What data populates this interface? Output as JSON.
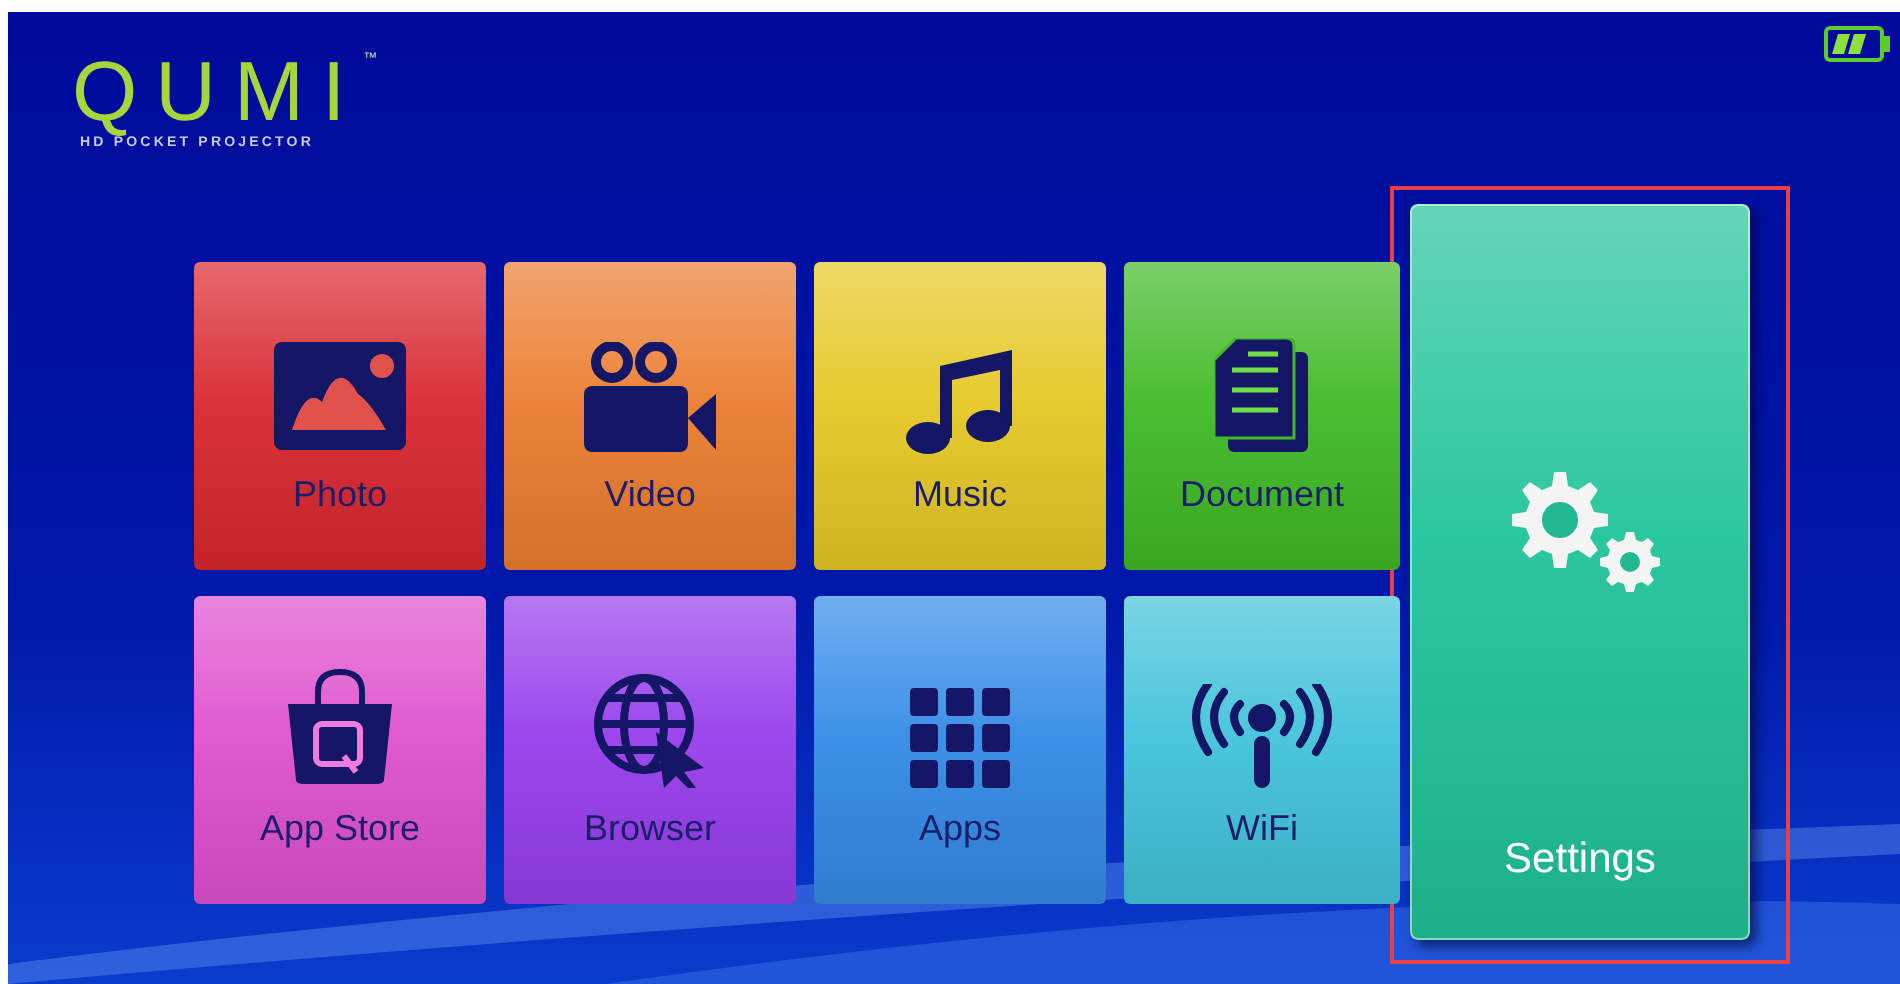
{
  "logo": {
    "name": "QUMI",
    "trademark": "™",
    "tagline": "HD POCKET PROJECTOR"
  },
  "tiles": [
    {
      "label": "Photo",
      "color": "#e0262e",
      "selected": false
    },
    {
      "label": "Video",
      "color": "#f07c2a",
      "selected": false
    },
    {
      "label": "Music",
      "color": "#e8c81c",
      "selected": false
    },
    {
      "label": "Document",
      "color": "#3cbc20",
      "selected": false
    },
    {
      "label": "App Store",
      "color": "#e44fd2",
      "selected": false
    },
    {
      "label": "Browser",
      "color": "#9a3cf4",
      "selected": false
    },
    {
      "label": "Apps",
      "color": "#2f8cec",
      "selected": false
    },
    {
      "label": "WiFi",
      "color": "#3cc4dc",
      "selected": false
    }
  ],
  "settings": {
    "label": "Settings",
    "color": "#20c49a",
    "selected": true
  }
}
